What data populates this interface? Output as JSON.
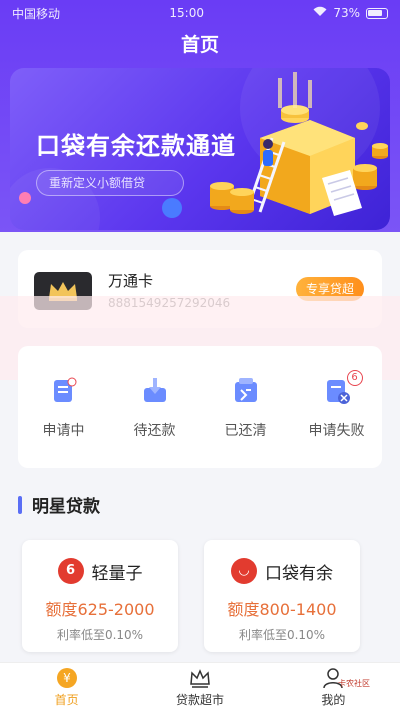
{
  "status_bar": {
    "carrier": "中国移动",
    "time": "15:00",
    "battery": "73%"
  },
  "header": {
    "title": "首页"
  },
  "banner": {
    "headline": "口袋有余还款通道",
    "subline": "重新定义小额借贷"
  },
  "member_card": {
    "name": "万通卡",
    "number": "8881549257292046",
    "button": "专享贷超"
  },
  "loan_status": {
    "items": [
      {
        "label": "申请中",
        "icon": "document-icon"
      },
      {
        "label": "待还款",
        "icon": "inbox-download-icon"
      },
      {
        "label": "已还清",
        "icon": "paid-check-icon"
      },
      {
        "label": "申请失败",
        "icon": "document-fail-icon",
        "badge": "6"
      }
    ]
  },
  "section": {
    "title": "明星贷款"
  },
  "loans": [
    {
      "logo_char": "6",
      "name": "轻量子",
      "amount": "额度625-2000",
      "rate": "利率低至0.10%"
    },
    {
      "logo_char": "◡",
      "name": "口袋有余",
      "amount": "额度800-1400",
      "rate": "利率低至0.10%"
    }
  ],
  "tabbar": {
    "items": [
      {
        "label": "首页",
        "icon": "home-yen-icon",
        "active": true
      },
      {
        "label": "贷款超市",
        "icon": "crown-icon",
        "active": false
      },
      {
        "label": "我的",
        "icon": "user-icon",
        "active": false
      }
    ]
  },
  "watermark_text": "卡农社区"
}
